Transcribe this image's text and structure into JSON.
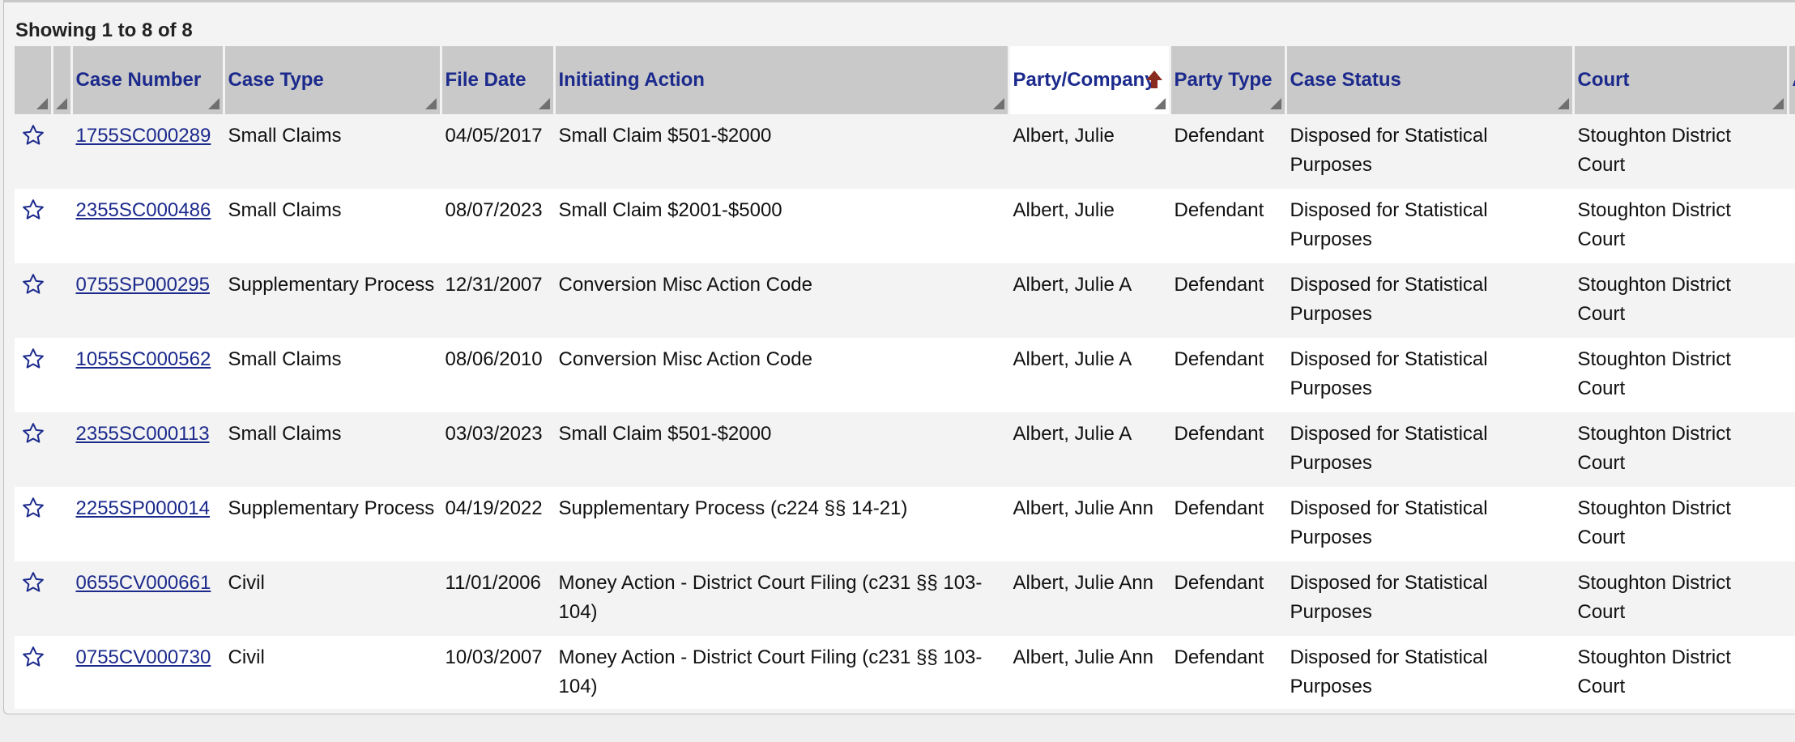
{
  "summary": "Showing 1 to 8 of 8",
  "columns": {
    "case_number": "Case Number",
    "case_type": "Case Type",
    "file_date": "File Date",
    "initiating_action": "Initiating Action",
    "party_company": "Party/Company",
    "party_type": "Party Type",
    "case_status": "Case Status",
    "court": "Court",
    "extra": "A"
  },
  "rows": [
    {
      "case_number": "1755SC000289",
      "case_type": "Small Claims",
      "file_date": "04/05/2017",
      "initiating_action": "Small Claim $501-$2000",
      "party": "Albert, Julie",
      "party_type": "Defendant",
      "status": "Disposed for Statistical Purposes",
      "court": "Stoughton District Court"
    },
    {
      "case_number": "2355SC000486",
      "case_type": "Small Claims",
      "file_date": "08/07/2023",
      "initiating_action": "Small Claim $2001-$5000",
      "party": "Albert, Julie",
      "party_type": "Defendant",
      "status": "Disposed for Statistical Purposes",
      "court": "Stoughton District Court"
    },
    {
      "case_number": "0755SP000295",
      "case_type": "Supplementary Process",
      "file_date": "12/31/2007",
      "initiating_action": "Conversion Misc Action Code",
      "party": "Albert, Julie A",
      "party_type": "Defendant",
      "status": "Disposed for Statistical Purposes",
      "court": "Stoughton District Court"
    },
    {
      "case_number": "1055SC000562",
      "case_type": "Small Claims",
      "file_date": "08/06/2010",
      "initiating_action": "Conversion Misc Action Code",
      "party": "Albert, Julie A",
      "party_type": "Defendant",
      "status": "Disposed for Statistical Purposes",
      "court": "Stoughton District Court"
    },
    {
      "case_number": "2355SC000113",
      "case_type": "Small Claims",
      "file_date": "03/03/2023",
      "initiating_action": "Small Claim $501-$2000",
      "party": "Albert, Julie A",
      "party_type": "Defendant",
      "status": "Disposed for Statistical Purposes",
      "court": "Stoughton District Court"
    },
    {
      "case_number": "2255SP000014",
      "case_type": "Supplementary Process",
      "file_date": "04/19/2022",
      "initiating_action": "Supplementary Process (c224 §§ 14-21)",
      "party": "Albert, Julie Ann",
      "party_type": "Defendant",
      "status": "Disposed for Statistical Purposes",
      "court": "Stoughton District Court"
    },
    {
      "case_number": "0655CV000661",
      "case_type": "Civil",
      "file_date": "11/01/2006",
      "initiating_action": "Money Action - District Court Filing (c231 §§ 103-104)",
      "party": "Albert, Julie Ann",
      "party_type": "Defendant",
      "status": "Disposed for Statistical Purposes",
      "court": "Stoughton District Court"
    },
    {
      "case_number": "0755CV000730",
      "case_type": "Civil",
      "file_date": "10/03/2007",
      "initiating_action": "Money Action - District Court Filing (c231 §§ 103-104)",
      "party": "Albert, Julie Ann",
      "party_type": "Defendant",
      "status": "Disposed for Statistical Purposes",
      "court": "Stoughton District Court"
    }
  ],
  "icons": {
    "favorite": "star-outline-icon",
    "resize": "column-resize-icon",
    "sort": "sort-ascending-icon"
  },
  "colors": {
    "header_bg": "#c9c9c9",
    "header_text": "#1b2a8c",
    "active_header_bg": "#ffffff",
    "row_alt_bg": "#f3f3f3",
    "row_bg": "#ffffff",
    "link": "#1b2a8c",
    "sort_arrow": "#8a2b1f"
  }
}
